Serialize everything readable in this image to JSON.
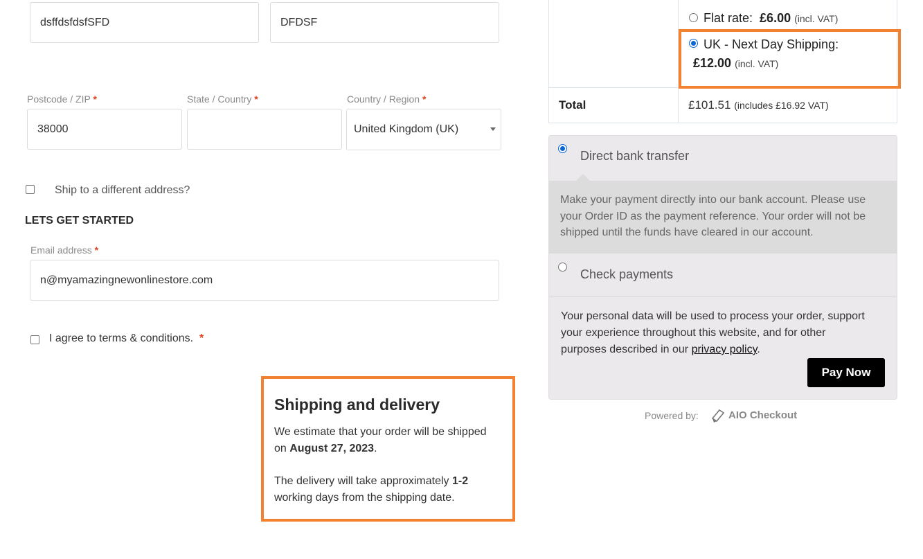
{
  "billing": {
    "first_name_value": "dsffdsfdsfSFD",
    "last_name_value": "DFDSF",
    "postcode_label": "Postcode / ZIP",
    "postcode_value": "38000",
    "state_label": "State / Country",
    "state_value": "",
    "country_label": "Country / Region",
    "country_value": "United Kingdom (UK)",
    "required_mark": "*"
  },
  "ship_different": {
    "label": "Ship to a different address?"
  },
  "section": {
    "title": "LETS GET STARTED"
  },
  "email": {
    "label": "Email address",
    "value": "n@myamazingnewonlinestore.com"
  },
  "terms": {
    "label": "I agree to terms & conditions."
  },
  "shipping_info": {
    "title": "Shipping and delivery",
    "line1_pre": "We estimate that your order will be shipped",
    "line2_pre": "on ",
    "date": "August 27, 2023",
    "line2_post": ".",
    "delivery_pre": "The delivery will take approximately ",
    "delivery_days": "1-2",
    "delivery_post": "working days from the shipping date."
  },
  "order_review": {
    "flat_rate_label": "Flat rate:",
    "flat_rate_price": "£6.00",
    "flat_rate_tax": "(incl. VAT)",
    "next_day_label": "UK - Next Day Shipping:",
    "next_day_price": "£12.00",
    "next_day_tax": "(incl. VAT)",
    "total_label": "Total",
    "total_value": "£101.51",
    "total_tax": "(includes £16.92 VAT)"
  },
  "payment": {
    "bank_label": "Direct bank transfer",
    "bank_desc_1": "Make your payment directly into our bank account. Please use",
    "bank_desc_2": "your Order ID as the payment reference. Your order will not be",
    "bank_desc_3": "shipped until the funds have cleared in our account.",
    "check_label": "Check payments",
    "privacy_1": "Your personal data will be used to process your order, support",
    "privacy_2": "your experience throughout this website, and for other",
    "privacy_3_pre": "purposes described in our ",
    "privacy_link": "privacy policy",
    "privacy_3_post": ".",
    "pay_button": "Pay Now"
  },
  "footer": {
    "powered_by": "Powered by:",
    "brand": "AIO Checkout"
  },
  "colors": {
    "highlight": "#f28130",
    "radio_selected": "#0a66d6",
    "required": "#e2401c"
  }
}
